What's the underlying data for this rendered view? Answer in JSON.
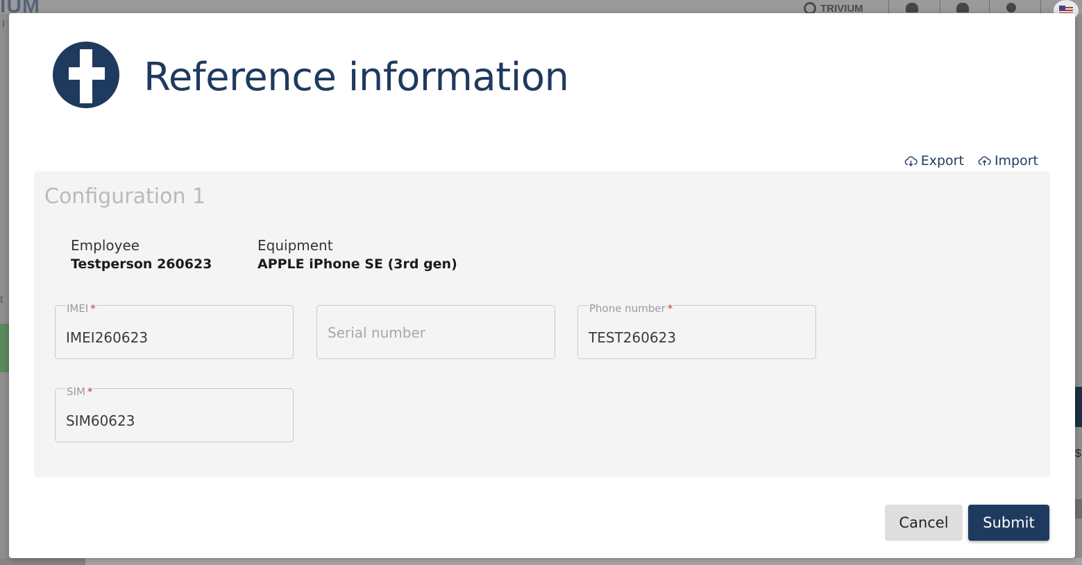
{
  "background": {
    "brand": "IUM",
    "brand_sub": "I",
    "trivium": "TRIVIUM",
    "left_glyph": "t",
    "right_glyph": "$"
  },
  "modal": {
    "title": "Reference information",
    "actions": {
      "export_label": "Export",
      "import_label": "Import"
    },
    "panel": {
      "title": "Configuration 1",
      "employee": {
        "label": "Employee",
        "value": "Testperson 260623"
      },
      "equipment": {
        "label": "Equipment",
        "value": "APPLE iPhone SE (3rd gen)"
      },
      "fields": {
        "imei": {
          "label": "IMEI",
          "required_mark": "*",
          "value": "IMEI260623"
        },
        "serial": {
          "placeholder": "Serial number",
          "value": ""
        },
        "phone": {
          "label": "Phone number",
          "required_mark": "*",
          "value": "TEST260623"
        },
        "sim": {
          "label": "SIM",
          "required_mark": "*",
          "value": "SIM60623"
        }
      }
    },
    "buttons": {
      "cancel_label": "Cancel",
      "submit_label": "Submit"
    }
  },
  "colors": {
    "brand": "#1f3a5f",
    "required": "#c0392b",
    "panel_bg": "#f4f4f4"
  },
  "icons": {
    "logo": "cross-logo-icon",
    "export": "cloud-download-icon",
    "import": "cloud-upload-icon"
  }
}
